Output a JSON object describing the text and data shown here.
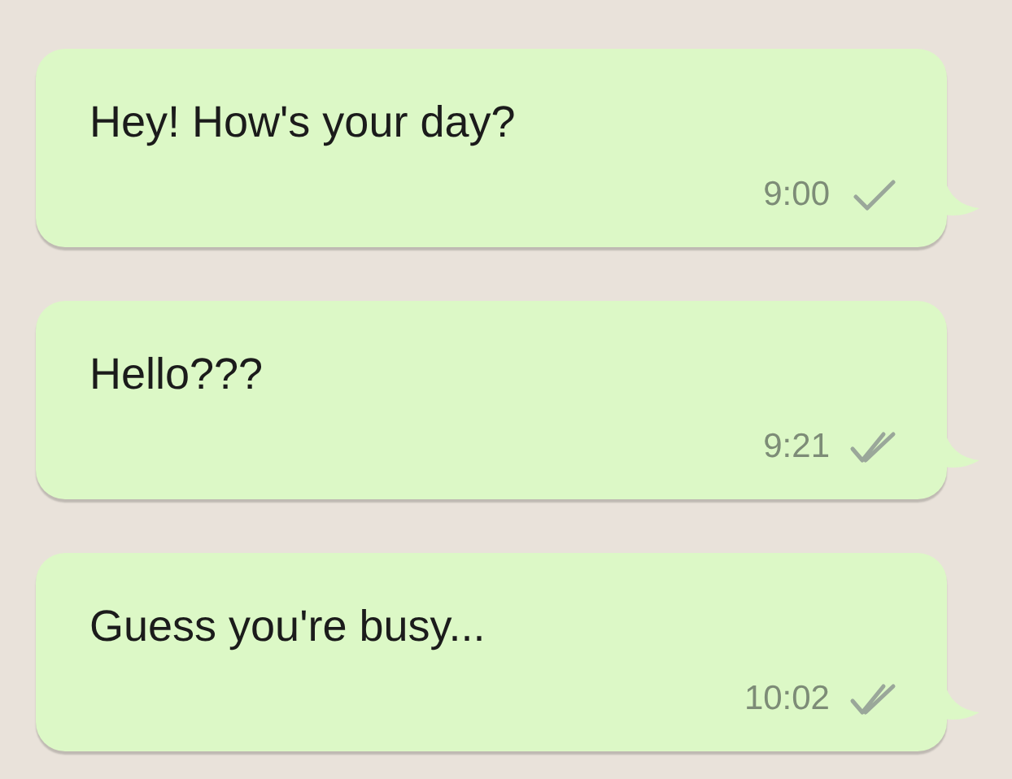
{
  "messages": [
    {
      "text": "Hey! How's your day?",
      "time": "9:00",
      "kind": "sent"
    },
    {
      "text": "Hello???",
      "time": "9:21",
      "kind": "delivered"
    },
    {
      "text": "Guess you're busy...",
      "time": "10:02",
      "kind": "delivered"
    }
  ]
}
